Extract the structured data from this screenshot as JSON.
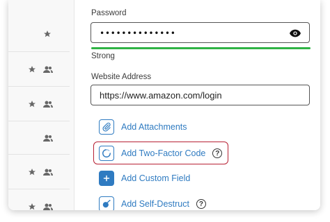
{
  "password": {
    "label": "Password",
    "value": "••••••••••••••",
    "strength_label": "Strong",
    "strength_color": "#2fb344",
    "strength_fraction": 1.0
  },
  "website": {
    "label": "Website Address",
    "value": "https://www.amazon.com/login"
  },
  "actions": {
    "attachments": "Add Attachments",
    "two_factor": "Add Two-Factor Code",
    "custom_field": "Add Custom Field",
    "self_destruct": "Add Self-Destruct"
  },
  "colors": {
    "accent": "#2f7bc1",
    "highlight": "#b72033"
  },
  "list_rows": [
    {
      "icons": [
        "star-icon"
      ]
    },
    {
      "icons": [
        "star-icon",
        "shared-people-icon"
      ]
    },
    {
      "icons": [
        "star-icon",
        "shared-people-icon"
      ]
    },
    {
      "icons": [
        "shared-people-icon"
      ]
    },
    {
      "icons": [
        "star-icon",
        "shared-people-icon"
      ]
    },
    {
      "icons": [
        "star-icon",
        "shared-people-icon"
      ]
    }
  ]
}
